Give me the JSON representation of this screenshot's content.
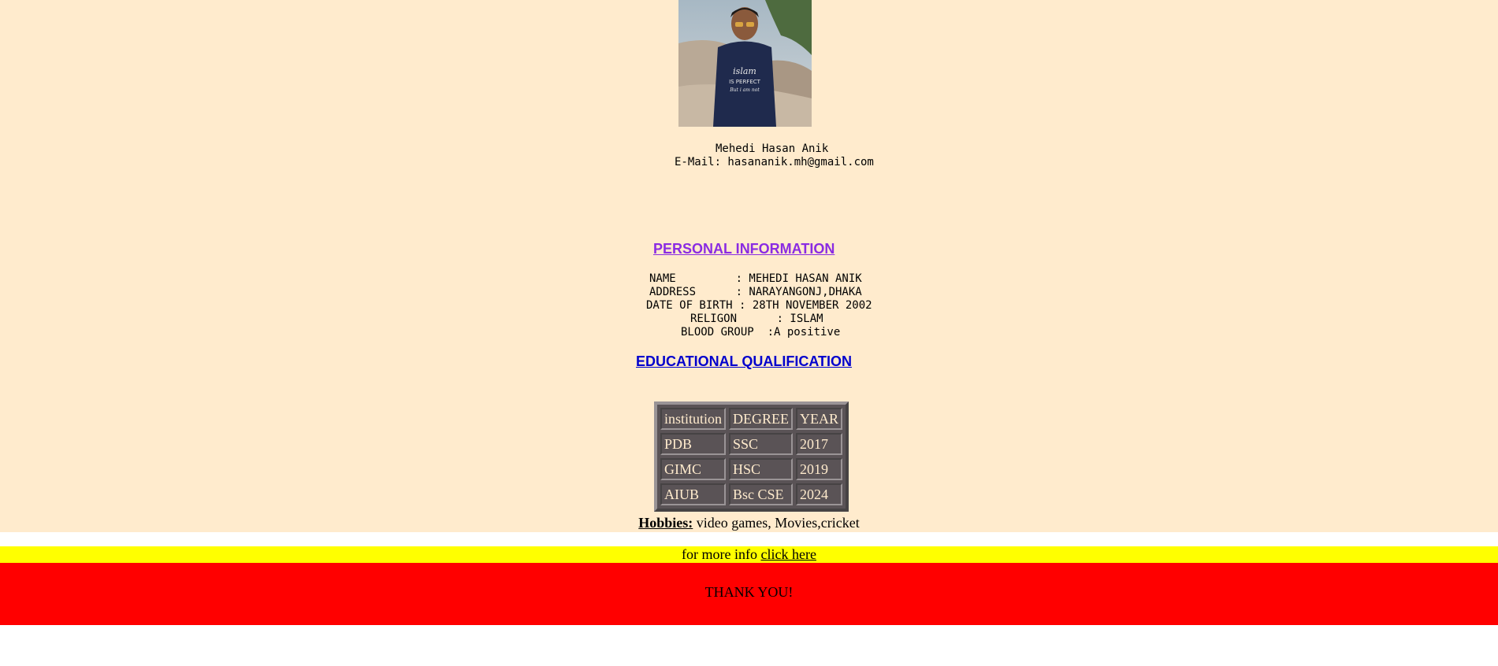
{
  "profile": {
    "photo_alt": "profile-photo",
    "name": "Mehedi Hasan Anik",
    "email_line": "E-Mail: hasananik.mh@gmail.com"
  },
  "personal": {
    "heading": "PERSONAL INFORMATION",
    "lines": [
      "NAME         : MEHEDI HASAN ANIK",
      "ADDRESS      : NARAYANGONJ,DHAKA",
      "DATE OF BIRTH : 28TH NOVEMBER 2002",
      "RELIGON      : ISLAM",
      "BLOOD GROUP  :A positive"
    ]
  },
  "education": {
    "heading": "EDUCATIONAL QUALIFICATION",
    "headers": [
      "institution",
      "DEGREE",
      "YEAR"
    ],
    "rows": [
      [
        "PDB",
        "SSC",
        "2017"
      ],
      [
        "GIMC",
        "HSC",
        "2019"
      ],
      [
        "AIUB",
        "Bsc CSE",
        "2024"
      ]
    ]
  },
  "hobbies": {
    "label": "Hobbies:",
    "text": " video games, Movies,cricket"
  },
  "footer": {
    "more_info_text": "for more info ",
    "link_text": "click here",
    "thanks": "THANK YOU!"
  },
  "colors": {
    "page_bg": "#ffebcd",
    "personal_heading": "#8a2be2",
    "education_heading": "#0000cd",
    "info_bar": "#ffff00",
    "thanks_bar": "#ff0000"
  }
}
